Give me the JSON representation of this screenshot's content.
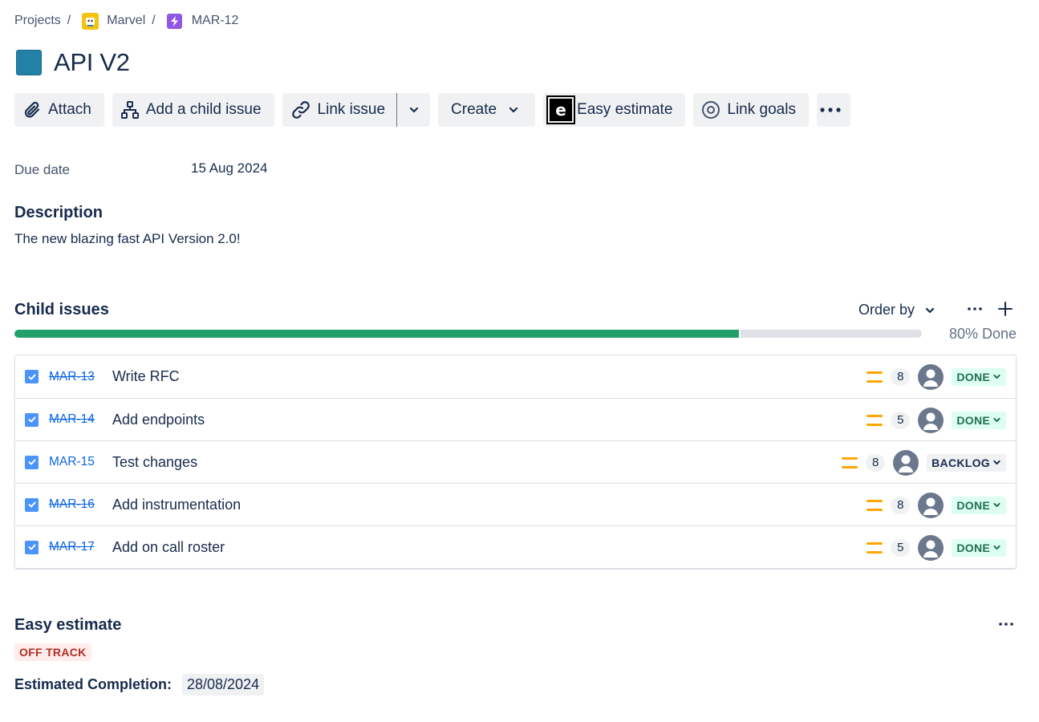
{
  "breadcrumb": {
    "projects": "Projects",
    "separator": "/",
    "project": "Marvel",
    "parent": "MAR-12"
  },
  "issue": {
    "title": "API V2",
    "type_color": "#2281a6"
  },
  "toolbar": {
    "attach": "Attach",
    "add_child": "Add a child issue",
    "link_issue": "Link issue",
    "create": "Create",
    "easy_estimate": "Easy estimate",
    "easy_estimate_logo": "e",
    "link_goals": "Link goals"
  },
  "fields": {
    "due_date_label": "Due date",
    "due_date_value": "15 Aug 2024"
  },
  "description": {
    "heading": "Description",
    "text": "The new blazing fast API Version 2.0!"
  },
  "child_issues": {
    "heading": "Child issues",
    "order_by": "Order by",
    "progress_percent": 80,
    "progress_label": "80% Done",
    "items": [
      {
        "key": "MAR-13",
        "summary": "Write RFC",
        "priority": "medium",
        "points": "8",
        "status": "DONE",
        "done": true
      },
      {
        "key": "MAR-14",
        "summary": "Add endpoints",
        "priority": "medium",
        "points": "5",
        "status": "DONE",
        "done": true
      },
      {
        "key": "MAR-15",
        "summary": "Test changes",
        "priority": "medium",
        "points": "8",
        "status": "BACKLOG",
        "done": false
      },
      {
        "key": "MAR-16",
        "summary": "Add instrumentation",
        "priority": "medium",
        "points": "8",
        "status": "DONE",
        "done": true
      },
      {
        "key": "MAR-17",
        "summary": "Add on call roster",
        "priority": "medium",
        "points": "5",
        "status": "DONE",
        "done": true
      }
    ]
  },
  "easy_estimate": {
    "heading": "Easy estimate",
    "status": "OFF TRACK",
    "completion_label": "Estimated Completion:",
    "completion_date": "28/08/2024"
  },
  "colors": {
    "progress_done": "#22a06b",
    "link": "#0c66e4",
    "priority_medium": "#ffa500",
    "status_done_bg": "#dcfff1",
    "status_done_text": "#216e4e",
    "off_track_bg": "#ffeceb",
    "off_track_text": "#ae2e24"
  }
}
